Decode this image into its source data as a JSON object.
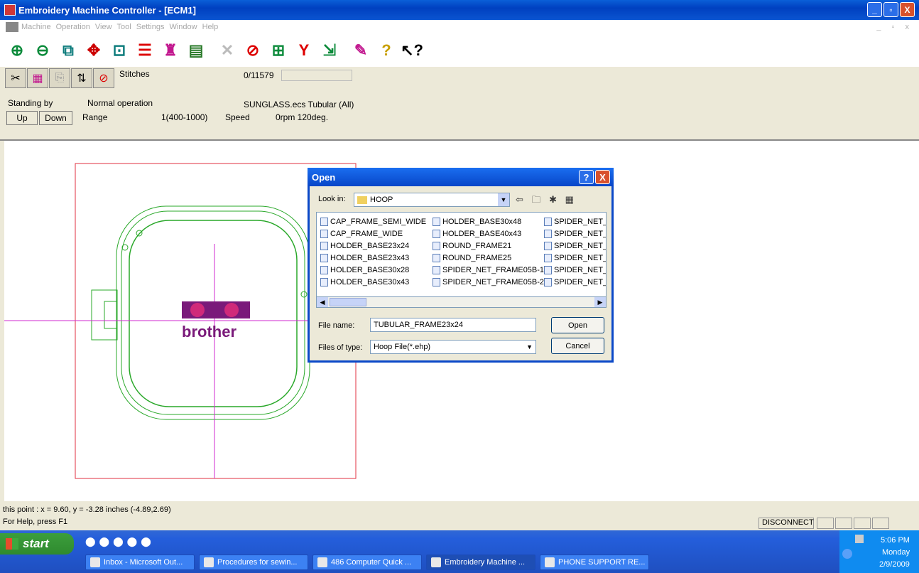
{
  "window": {
    "title": "Embroidery Machine Controller - [ECM1]",
    "btn_min": "_",
    "btn_max": "▫",
    "btn_close": "X"
  },
  "menu": {
    "items": [
      "Machine",
      "Operation",
      "View",
      "Tool",
      "Settings",
      "Window",
      "Help"
    ],
    "mdi_controls": "_ ▫ x"
  },
  "toolbar": {
    "icons": [
      "zoom-in",
      "zoom-out",
      "zoom-area",
      "fit-all",
      "fit-hoop",
      "align-lines",
      "thread-spool",
      "color-bar",
      "cancel-x",
      "stop-circle",
      "frame-grid",
      "select-y",
      "cursor-arrow",
      "sheet-edit",
      "help-question",
      "context-help"
    ]
  },
  "status": {
    "stitches_label": "Stitches",
    "stitches_value": "0/11579",
    "state": "Standing by",
    "operation": "Normal operation",
    "file": "SUNGLASS.ecs Tubular (All)",
    "up_label": "Up",
    "down_label": "Down",
    "range_label": "Range",
    "range_value": "1(400-1000)",
    "speed_label": "Speed",
    "speed_value": "0rpm 120deg."
  },
  "canvas": {
    "logo_text": "brother"
  },
  "bottom": {
    "point": "this point : x = 9.60, y = -3.28 inches (-4.89,2.69)",
    "help": "For Help, press F1",
    "connection": "DISCONNECT"
  },
  "dialog": {
    "title": "Open",
    "help_btn": "?",
    "close_btn": "X",
    "look_in_label": "Look in:",
    "look_in_value": "HOOP",
    "nav_icons": "⇦ 🗀 ✱ ▦",
    "columns": [
      [
        "CAP_FRAME_SEMI_WIDE",
        "CAP_FRAME_WIDE",
        "HOLDER_BASE23x24",
        "HOLDER_BASE23x43",
        "HOLDER_BASE30x28",
        "HOLDER_BASE30x43"
      ],
      [
        "HOLDER_BASE30x48",
        "HOLDER_BASE40x43",
        "ROUND_FRAME21",
        "ROUND_FRAME25",
        "SPIDER_NET_FRAME05B-1",
        "SPIDER_NET_FRAME05B-2"
      ],
      [
        "SPIDER_NET_F",
        "SPIDER_NET_F",
        "SPIDER_NET_F",
        "SPIDER_NET_F",
        "SPIDER_NET_F",
        "SPIDER_NET_F"
      ]
    ],
    "file_name_label": "File name:",
    "file_name_value": "TUBULAR_FRAME23x24",
    "file_type_label": "Files of type:",
    "file_type_value": "Hoop File(*.ehp)",
    "open_btn": "Open",
    "cancel_btn": "Cancel"
  },
  "taskbar": {
    "start": "start",
    "tasks": [
      "Inbox - Microsoft Out...",
      "Procedures for sewin...",
      "486 Computer Quick ...",
      "Embroidery Machine ...",
      "PHONE SUPPORT RE..."
    ],
    "time": "5:06 PM",
    "day": "Monday",
    "date": "2/9/2009"
  }
}
